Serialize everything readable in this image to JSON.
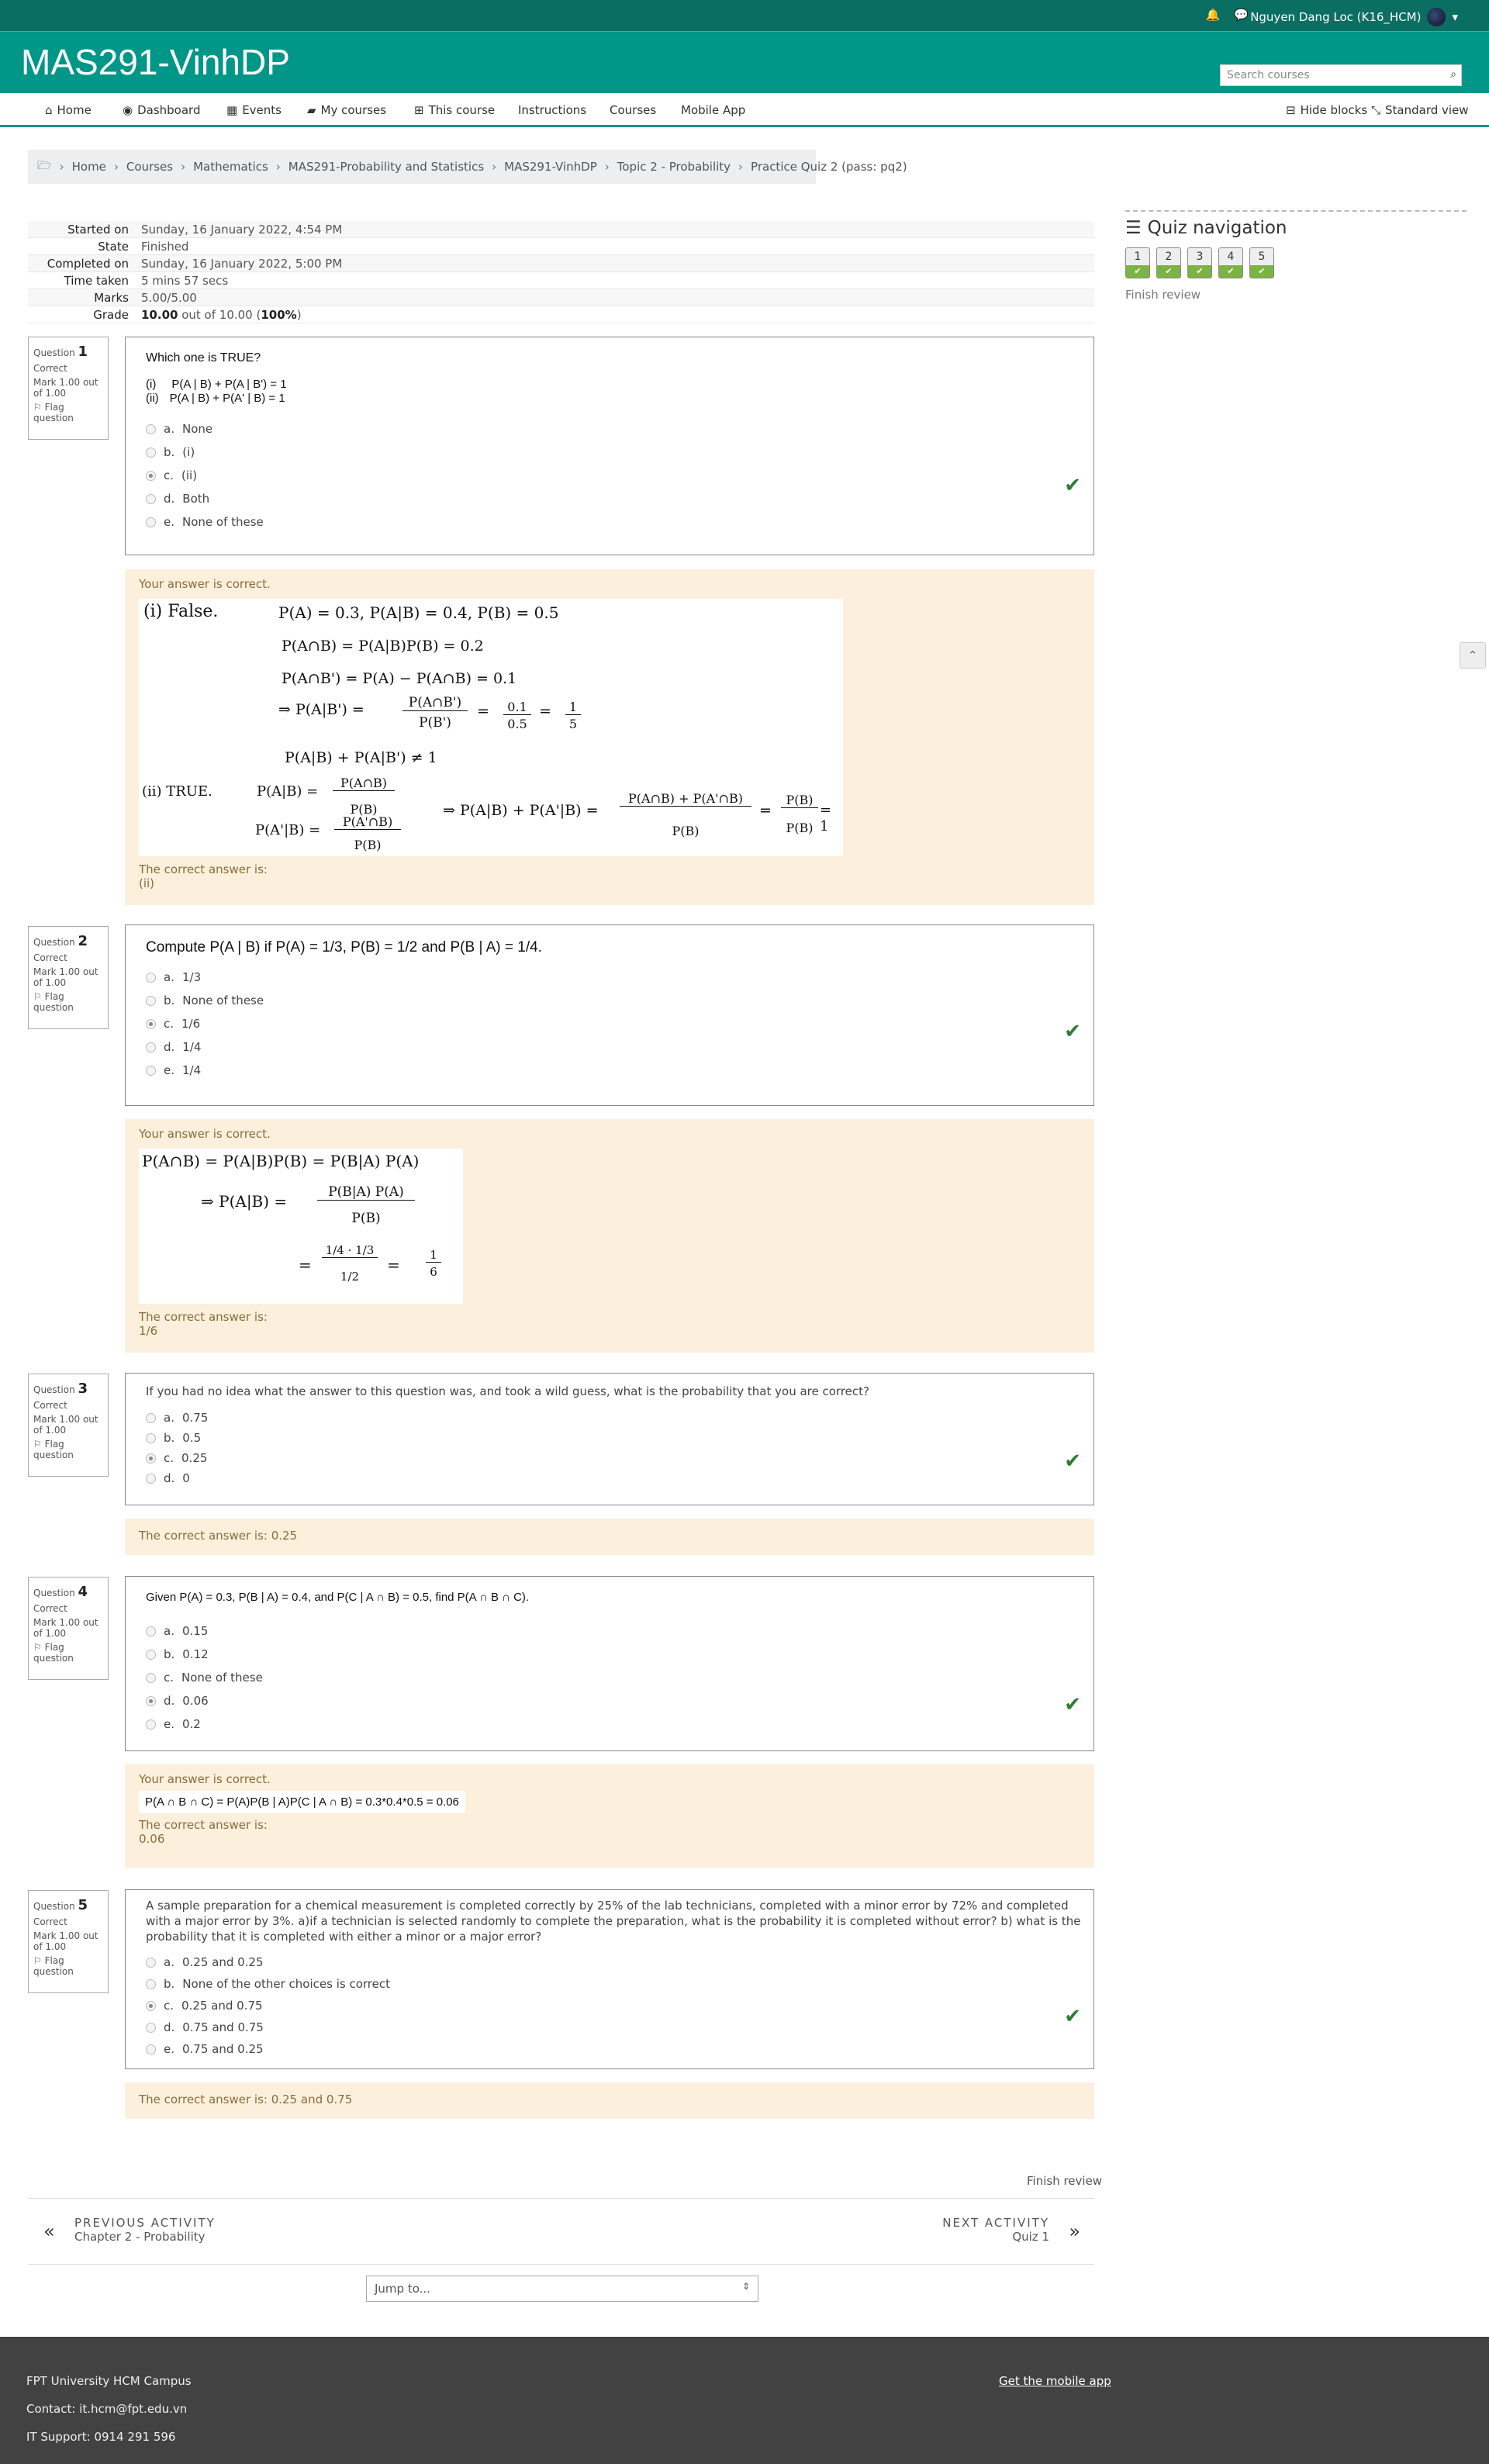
{
  "topbar": {
    "user_name": "Nguyen Dang Loc (K16_HCM)"
  },
  "site": {
    "title": "MAS291-VinhDP",
    "search_placeholder": "Search courses"
  },
  "nav": {
    "items": [
      "Home",
      "Dashboard",
      "Events",
      "My courses",
      "This course",
      "Instructions",
      "Courses",
      "Mobile App"
    ],
    "hide_blocks": "Hide blocks",
    "standard_view": "Standard view"
  },
  "breadcrumb": [
    "Home",
    "Courses",
    "Mathematics",
    "MAS291-Probability and Statistics",
    "MAS291-VinhDP",
    "Topic 2 - Probability",
    "Practice Quiz 2 (pass: pq2)"
  ],
  "summary": {
    "started_label": "Started on",
    "started": "Sunday, 16 January 2022, 4:54 PM",
    "state_label": "State",
    "state": "Finished",
    "completed_label": "Completed on",
    "completed": "Sunday, 16 January 2022, 5:00 PM",
    "time_label": "Time taken",
    "time": "5 mins 57 secs",
    "marks_label": "Marks",
    "marks": "5.00/5.00",
    "grade_label": "Grade",
    "grade_bold": "10.00",
    "grade_rest": " out of 10.00 (",
    "grade_pct": "100%",
    "grade_close": ")"
  },
  "quiz_nav": {
    "title": "Quiz navigation",
    "buttons": [
      "1",
      "2",
      "3",
      "4",
      "5"
    ],
    "finish_review": "Finish review"
  },
  "common": {
    "question_label": "Question",
    "status": "Correct",
    "mark": "Mark 1.00 out of 1.00",
    "flag": "Flag question",
    "your_answer": "Your answer is correct.",
    "correct_answer_is": "The correct answer is:"
  },
  "q1": {
    "number": "1",
    "text": "Which one is TRUE?",
    "line1_num": "(i)",
    "line1": "P(A | B) + P(A | B') = 1",
    "line2_num": "(ii)",
    "line2": "P(A | B) + P(A' | B) = 1",
    "options": [
      {
        "letter": "a.",
        "text": "None"
      },
      {
        "letter": "b.",
        "text": "(i)"
      },
      {
        "letter": "c.",
        "text": "(ii)"
      },
      {
        "letter": "d.",
        "text": "Both"
      },
      {
        "letter": "e.",
        "text": "None of these"
      }
    ],
    "correct_answer": "(ii)",
    "solution": {
      "l1a": "(i) False.",
      "l1b": "P(A) = 0.3,  P(A|B) = 0.4, P(B) = 0.5",
      "l2": "P(A∩B) = P(A|B)P(B) = 0.2",
      "l3": "P(A∩B') = P(A) − P(A∩B) = 0.1",
      "l4a": "⇒ P(A|B') =",
      "l4b": "P(A∩B')",
      "l4c": "P(B')",
      "l4d": "=",
      "l4e": "0.1",
      "l4f": "0.5",
      "l4g": "=",
      "l4h": "1",
      "l4i": "5",
      "l5": "P(A|B) + P(A|B') ≠ 1",
      "l6a": "(ii) TRUE.",
      "l6b": "P(A|B) =",
      "l6c": "P(A∩B)",
      "l6d": "P(B)",
      "l7a": "P(A'|B) =",
      "l7b": "P(A'∩B)",
      "l7c": "P(B)",
      "l8a": "⇒ P(A|B) + P(A'|B) =",
      "l8b": "P(A∩B) + P(A'∩B)",
      "l8c": "P(B)",
      "l8d": "=",
      "l8e": "P(B)",
      "l8f": "P(B)",
      "l8g": "= 1"
    }
  },
  "q2": {
    "number": "2",
    "text": "Compute P(A | B) if P(A) = 1/3, P(B) = 1/2 and P(B | A) = 1/4.",
    "options": [
      {
        "letter": "a.",
        "text": "1/3"
      },
      {
        "letter": "b.",
        "text": "None of these"
      },
      {
        "letter": "c.",
        "text": "1/6"
      },
      {
        "letter": "d.",
        "text": "1/4"
      },
      {
        "letter": "e.",
        "text": "1/4"
      }
    ],
    "correct_answer": "1/6",
    "solution": {
      "l1": "P(A∩B) = P(A|B)P(B) = P(B|A) P(A)",
      "l2a": "⇒ P(A|B) =",
      "l2b": "P(B|A) P(A)",
      "l2c": "P(B)",
      "l3a": "=",
      "l3b": "1/4 · 1/3",
      "l3c": "1/2",
      "l3d": "=",
      "l3e": "1",
      "l3f": "6"
    }
  },
  "q3": {
    "number": "3",
    "text": "If you had no idea what the answer to this question was, and took a wild guess, what is the probability that you are correct?",
    "options": [
      {
        "letter": "a.",
        "text": "0.75"
      },
      {
        "letter": "b.",
        "text": "0.5"
      },
      {
        "letter": "c.",
        "text": "0.25"
      },
      {
        "letter": "d.",
        "text": "0"
      }
    ],
    "correct_line": "The correct answer is: 0.25"
  },
  "q4": {
    "number": "4",
    "text": "Given P(A) = 0.3, P(B | A) = 0.4, and P(C | A ∩ B) = 0.5, find P(A ∩ B ∩ C).",
    "options": [
      {
        "letter": "a.",
        "text": "0.15"
      },
      {
        "letter": "b.",
        "text": "0.12"
      },
      {
        "letter": "c.",
        "text": "None of these"
      },
      {
        "letter": "d.",
        "text": "0.06"
      },
      {
        "letter": "e.",
        "text": "0.2"
      }
    ],
    "solution": "P(A ∩ B ∩ C) = P(A)P(B | A)P(C | A ∩ B) = 0.3*0.4*0.5 = 0.06",
    "correct_answer": "0.06"
  },
  "q5": {
    "number": "5",
    "text": "A sample preparation for a chemical measurement is completed correctly by 25% of the lab technicians, completed with a minor error by 72% and completed with a major error by 3%. a)if a technician is selected randomly to complete the preparation, what is the probability it is completed without error? b) what is the probability that it is completed with either a minor or a major error?",
    "options": [
      {
        "letter": "a.",
        "text": "0.25 and 0.25"
      },
      {
        "letter": "b.",
        "text": "None of the other choices is correct"
      },
      {
        "letter": "c.",
        "text": "0.25 and 0.75"
      },
      {
        "letter": "d.",
        "text": "0.75 and 0.75"
      },
      {
        "letter": "e.",
        "text": "0.75 and 0.25"
      }
    ],
    "correct_line": "The correct answer is: 0.25 and 0.75"
  },
  "bottom": {
    "finish_review": "Finish review",
    "prev_caption": "PREVIOUS ACTIVITY",
    "prev_title": "Chapter 2 - Probability",
    "next_caption": "NEXT ACTIVITY",
    "next_title": "Quiz 1",
    "jump": "Jump to..."
  },
  "footer": {
    "campus": "FPT University HCM Campus",
    "contact": "Contact: it.hcm@fpt.edu.vn",
    "support": "IT Support: 0914 291 596",
    "mobile_app": "Get the mobile app"
  }
}
